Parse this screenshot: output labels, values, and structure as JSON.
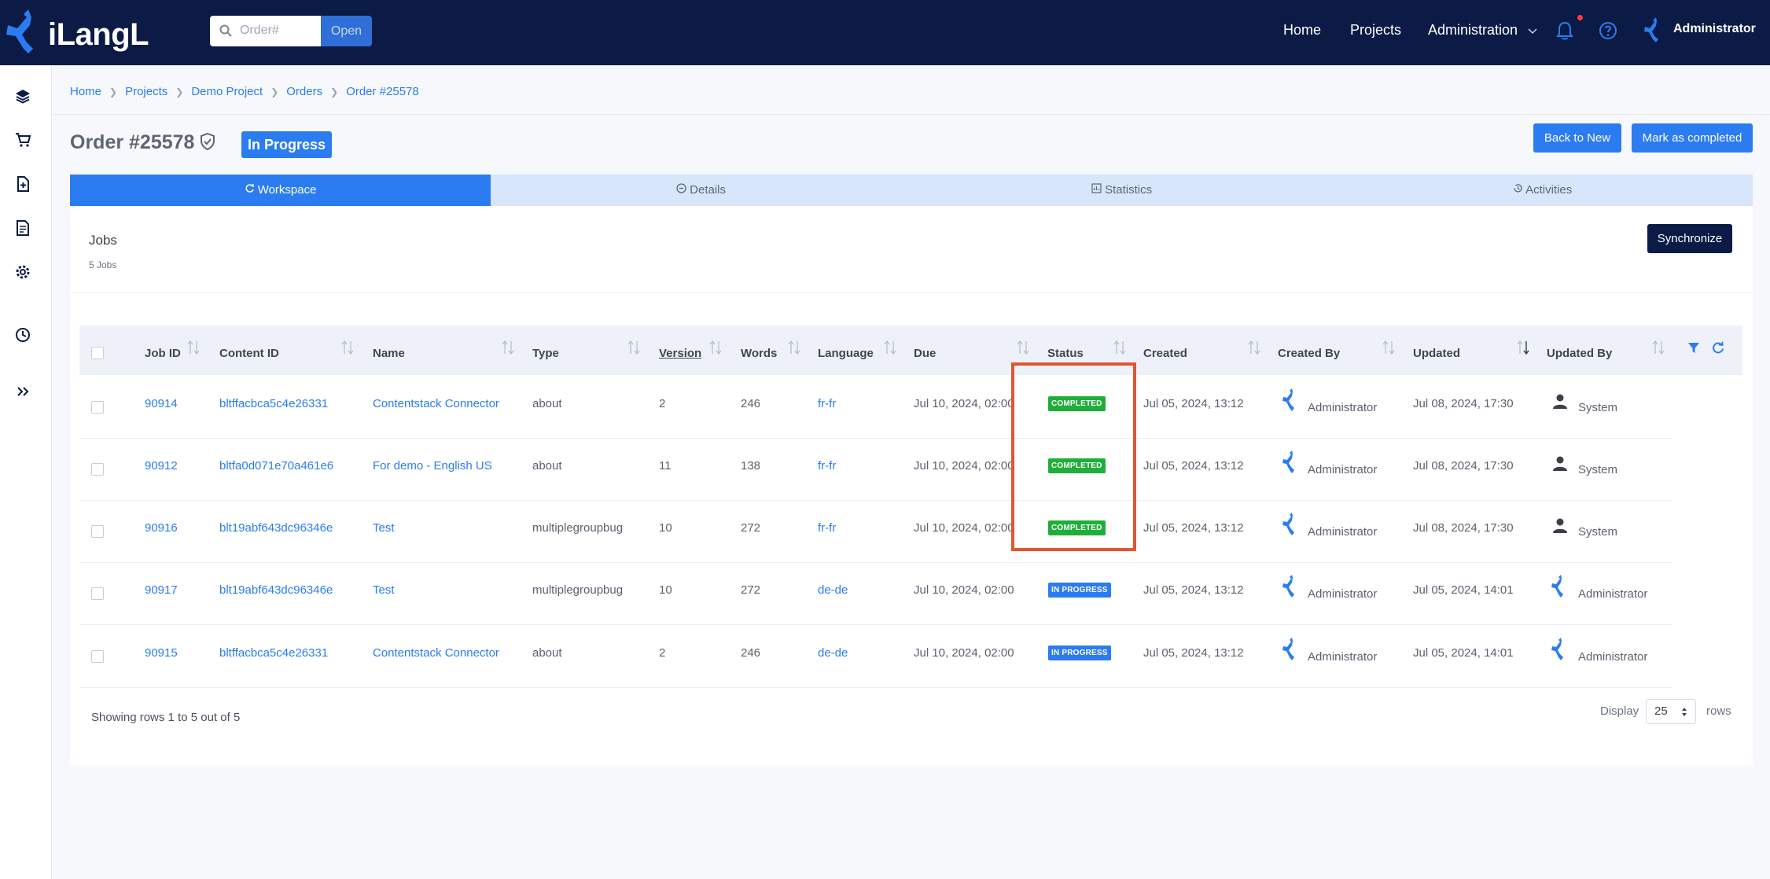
{
  "topbar": {
    "logo_text": "iLangL",
    "search_placeholder": "Order#",
    "open_label": "Open",
    "nav": [
      "Home",
      "Projects",
      "Administration"
    ],
    "user_name": "Administrator"
  },
  "rail_icons": [
    "layers-icon",
    "cart-icon",
    "file-add-icon",
    "documents-icon",
    "gear-icon",
    "clock-icon",
    "expand-icon"
  ],
  "breadcrumb": [
    "Home",
    "Projects",
    "Demo Project",
    "Orders",
    "Order #25578"
  ],
  "page": {
    "title": "Order #25578",
    "status": "In Progress",
    "back_to_new": "Back to New",
    "mark_completed": "Mark as completed"
  },
  "tabs": [
    "Workspace",
    "Details",
    "Statistics",
    "Activities"
  ],
  "jobs": {
    "title": "Jobs",
    "count": "5 Jobs",
    "sync_label": "Synchronize"
  },
  "table": {
    "columns": [
      "Job ID",
      "Content ID",
      "Name",
      "Type",
      "Version",
      "Words",
      "Language",
      "Due",
      "Status",
      "Created",
      "Created By",
      "Updated",
      "Updated By"
    ],
    "rows": [
      {
        "job_id": "90914",
        "content_id": "bltffacbca5c4e26331",
        "name": "Contentstack Connector",
        "type": "about",
        "version": "2",
        "words": "246",
        "language": "fr-fr",
        "due": "Jul 10, 2024, 02:00",
        "status": "COMPLETED",
        "created": "Jul 05, 2024, 13:12",
        "created_by": "Administrator",
        "updated": "Jul 08, 2024, 17:30",
        "updated_by": "System"
      },
      {
        "job_id": "90912",
        "content_id": "bltfa0d071e70a461e6",
        "name": "For demo - English US",
        "type": "about",
        "version": "11",
        "words": "138",
        "language": "fr-fr",
        "due": "Jul 10, 2024, 02:00",
        "status": "COMPLETED",
        "created": "Jul 05, 2024, 13:12",
        "created_by": "Administrator",
        "updated": "Jul 08, 2024, 17:30",
        "updated_by": "System"
      },
      {
        "job_id": "90916",
        "content_id": "blt19abf643dc96346e",
        "name": "Test",
        "type": "multiplegroupbug",
        "version": "10",
        "words": "272",
        "language": "fr-fr",
        "due": "Jul 10, 2024, 02:00",
        "status": "COMPLETED",
        "created": "Jul 05, 2024, 13:12",
        "created_by": "Administrator",
        "updated": "Jul 08, 2024, 17:30",
        "updated_by": "System"
      },
      {
        "job_id": "90917",
        "content_id": "blt19abf643dc96346e",
        "name": "Test",
        "type": "multiplegroupbug",
        "version": "10",
        "words": "272",
        "language": "de-de",
        "due": "Jul 10, 2024, 02:00",
        "status": "IN PROGRESS",
        "created": "Jul 05, 2024, 13:12",
        "created_by": "Administrator",
        "updated": "Jul 05, 2024, 14:01",
        "updated_by": "Administrator"
      },
      {
        "job_id": "90915",
        "content_id": "bltffacbca5c4e26331",
        "name": "Contentstack Connector",
        "type": "about",
        "version": "2",
        "words": "246",
        "language": "de-de",
        "due": "Jul 10, 2024, 02:00",
        "status": "IN PROGRESS",
        "created": "Jul 05, 2024, 13:12",
        "created_by": "Administrator",
        "updated": "Jul 05, 2024, 14:01",
        "updated_by": "Administrator"
      }
    ]
  },
  "footer": {
    "showing": "Showing rows 1 to 5 out of 5",
    "display_label": "Display",
    "page_size": "25",
    "rows_label": "rows"
  },
  "colors": {
    "navy": "#0b1b45",
    "accent": "#2b7cf0",
    "completed": "#1fae3a",
    "highlight": "#e05533"
  }
}
